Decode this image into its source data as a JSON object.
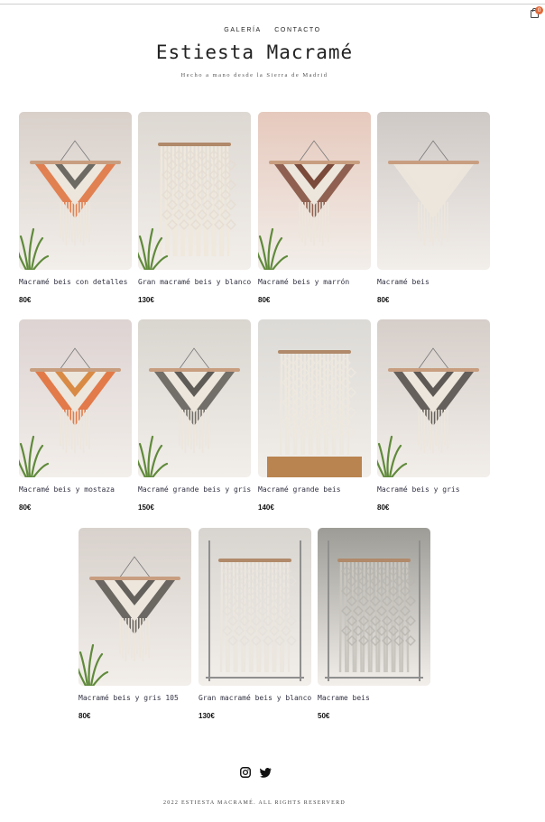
{
  "header": {
    "nav": [
      "GALERÍA",
      "CONTACTO"
    ],
    "cart_count": "0",
    "cart_icon": "cart-icon"
  },
  "brand": {
    "title": "Estiesta Macramé",
    "subtitle": "Hecho a mano desde la Sierra de Madrid"
  },
  "products": [
    {
      "name": "Macramé beis con detalles",
      "price": "80€",
      "bg": "#d9d0ca",
      "fringe": "#e07a4a",
      "accent": "#6d6a64",
      "plant": true
    },
    {
      "name": "Gran macramé beis y blanco",
      "price": "130€",
      "bg": "#ddd8d2",
      "fringe": "#efe8dc",
      "accent": "#e4ddd2",
      "plant": true
    },
    {
      "name": "Macramé beis y marrón",
      "price": "80€",
      "bg": "#e6c9bd",
      "fringe": "#8a5a4a",
      "accent": "#7a4a3a",
      "plant": true
    },
    {
      "name": "Macramé beis",
      "price": "80€",
      "bg": "#cfc9c6",
      "fringe": "#ece6dc",
      "accent": "#ece6dc",
      "plant": false
    },
    {
      "name": "Macramé beis y mostaza",
      "price": "80€",
      "bg": "#ddd3d2",
      "fringe": "#e27440",
      "accent": "#d98a45",
      "plant": true
    },
    {
      "name": "Macramé grande beis y gris",
      "price": "150€",
      "bg": "#d9d5cf",
      "fringe": "#6b6762",
      "accent": "#5f5b56",
      "plant": true
    },
    {
      "name": "Macramé grande beis",
      "price": "140€",
      "bg": "#dcdad6",
      "fringe": "#ede8df",
      "accent": "#ede8df",
      "plant": false
    },
    {
      "name": "Macramé beis y gris",
      "price": "80€",
      "bg": "#d6cec9",
      "fringe": "#5e5954",
      "accent": "#5e5954",
      "plant": true
    },
    {
      "name": "Macramé beis y gris 105",
      "price": "80€",
      "bg": "#d8d1cc",
      "fringe": "#64605b",
      "accent": "#64605b",
      "plant": true
    },
    {
      "name": "Gran macramé beis y blanco",
      "price": "130€",
      "bg": "#d8d4cf",
      "fringe": "#ebe6de",
      "accent": "#e4e0da",
      "plant": false
    },
    {
      "name": "Macrame beis",
      "price": "50€",
      "bg": "#9d9c96",
      "fringe": "#c9c6c0",
      "accent": "#b9b6b0",
      "plant": false
    }
  ],
  "social": [
    "instagram-icon",
    "twitter-icon"
  ],
  "footer": {
    "copyright": "2022 ESTIESTA MACRAMÉ. ALL RIGHTS RESERVERD"
  }
}
